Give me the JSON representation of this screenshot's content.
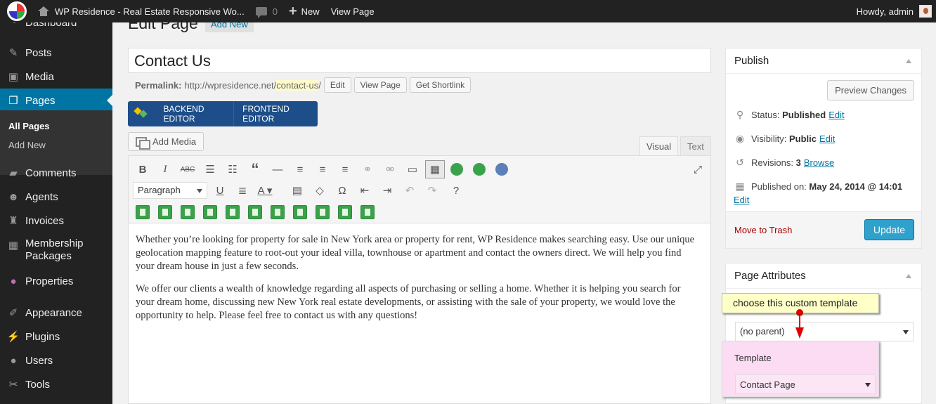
{
  "adminbar": {
    "site_name": "WP Residence - Real Estate Responsive Wo...",
    "comments_count": "0",
    "new_label": "New",
    "view_page": "View Page",
    "greeting": "Howdy, admin"
  },
  "sidebar": {
    "items": [
      {
        "label": "Dashboard"
      },
      {
        "label": "Posts"
      },
      {
        "label": "Media"
      },
      {
        "label": "Pages"
      },
      {
        "label": "Comments"
      },
      {
        "label": "Agents"
      },
      {
        "label": "Invoices"
      },
      {
        "label": "Membership Packages"
      },
      {
        "label": "Properties"
      },
      {
        "label": "Appearance"
      },
      {
        "label": "Plugins"
      },
      {
        "label": "Users"
      },
      {
        "label": "Tools"
      }
    ],
    "submenu": {
      "all_pages": "All Pages",
      "add_new": "Add New"
    }
  },
  "main": {
    "heading": "Edit Page",
    "add_new": "Add New",
    "title_value": "Contact Us",
    "permalink": {
      "label": "Permalink:",
      "base": "http://wpresidence.net/",
      "slug": "contact-us",
      "trail": "/",
      "edit": "Edit",
      "view": "View Page",
      "shortlink": "Get Shortlink"
    },
    "vc": {
      "backend": "BACKEND EDITOR",
      "frontend": "FRONTEND EDITOR"
    },
    "add_media": "Add Media",
    "tabs": {
      "visual": "Visual",
      "text": "Text"
    },
    "format_select": "Paragraph",
    "paragraphs": [
      "Whether you’re looking for property for sale in New York area or property for rent, WP Residence makes searching easy. Use our unique geolocation mapping feature to root-out your ideal villa, townhouse or apartment and contact the owners direct. We will help you find your dream house in just a few seconds.",
      "We offer our clients a wealth of knowledge regarding all aspects of purchasing or selling a home. Whether it is helping you search for your dream home, discussing new New York real estate developments, or assisting with the sale of your property, we would love the opportunity to help. Please feel free to contact us with any questions!"
    ]
  },
  "publish": {
    "title": "Publish",
    "preview": "Preview Changes",
    "status_label": "Status:",
    "status_value": "Published",
    "visibility_label": "Visibility:",
    "visibility_value": "Public",
    "revisions_label": "Revisions:",
    "revisions_value": "3",
    "browse": "Browse",
    "published_label": "Published on:",
    "published_value": "May 24, 2014 @ 14:01",
    "edit": "Edit",
    "trash": "Move to Trash",
    "update": "Update"
  },
  "attributes": {
    "title": "Page Attributes",
    "parent_value": "(no parent)",
    "template_label": "Template",
    "template_value": "Contact Page",
    "tooltip": "choose this custom template"
  },
  "colors": {
    "accent": "#0074a2",
    "adminbar": "#222222",
    "update": "#2ea2cc",
    "vc": "#1d4e89",
    "highlight": "#fcdcf2",
    "tooltip": "#ffffc8"
  }
}
